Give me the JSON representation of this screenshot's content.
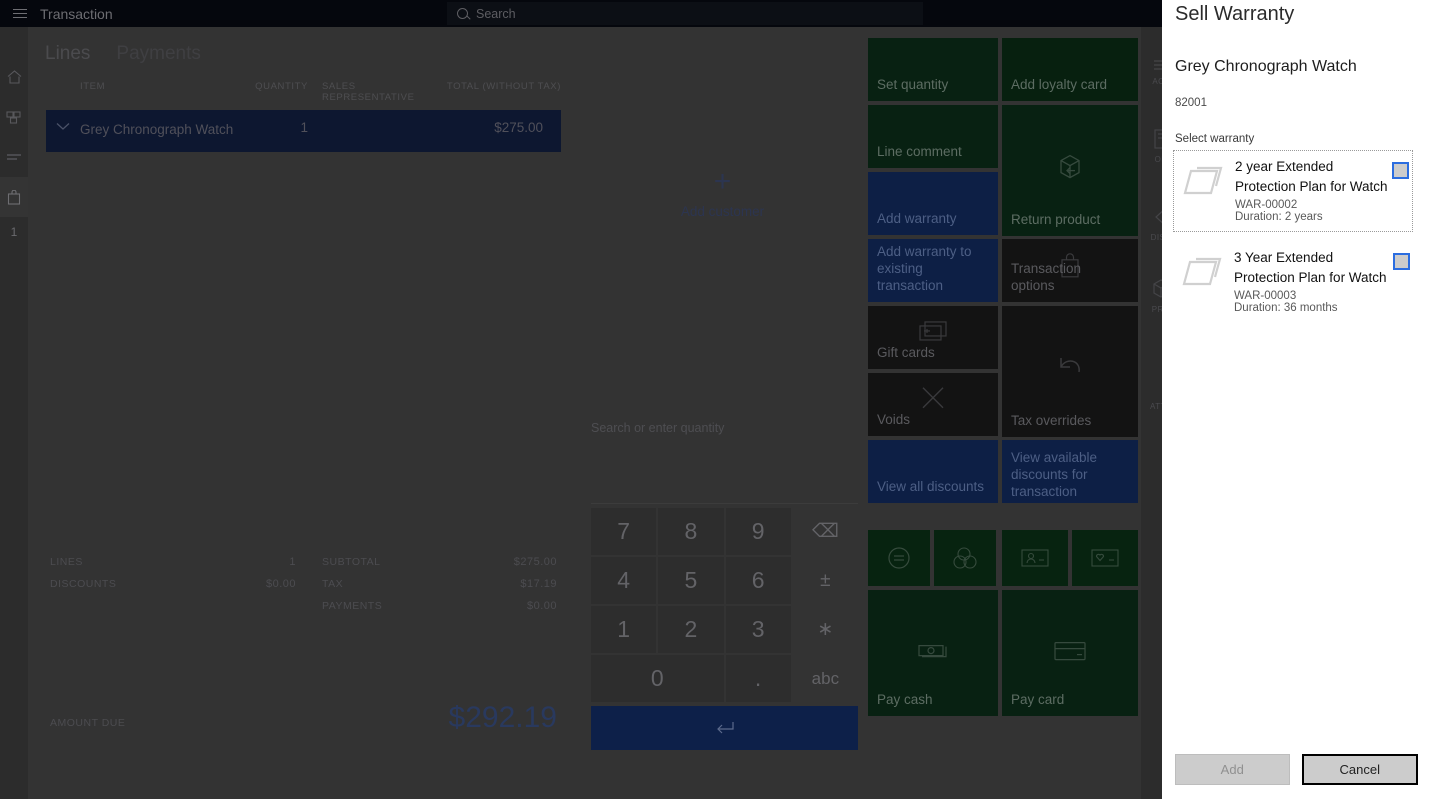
{
  "topbar": {
    "menu_icon": "hamburger-icon",
    "title": "Transaction",
    "search_icon": "search-icon",
    "search_placeholder": "Search"
  },
  "left_rail": {
    "items": [
      {
        "icon": "home-icon",
        "glyph": "⌂"
      },
      {
        "icon": "products-icon",
        "glyph": "❖"
      },
      {
        "icon": "lines-icon",
        "glyph": "≡"
      },
      {
        "icon": "cart-icon",
        "glyph": "▮"
      }
    ],
    "count": "1"
  },
  "transaction": {
    "tabs": [
      {
        "label": "Lines",
        "active": true
      },
      {
        "label": "Payments",
        "active": false
      }
    ],
    "columns": {
      "item": "ITEM",
      "quantity": "QUANTITY",
      "sales_rep": "SALES REPRESENTATIVE",
      "total": "TOTAL (WITHOUT TAX)"
    },
    "rows": [
      {
        "expand_icon": "chevron-down-icon",
        "item": "Grey Chronograph Watch",
        "quantity": "1",
        "sales_rep": "",
        "total": "$275.00"
      }
    ],
    "totals_left": [
      {
        "label": "LINES",
        "value": "1"
      },
      {
        "label": "DISCOUNTS",
        "value": "$0.00"
      }
    ],
    "totals_right": [
      {
        "label": "SUBTOTAL",
        "value": "$275.00"
      },
      {
        "label": "TAX",
        "value": "$17.19"
      },
      {
        "label": "PAYMENTS",
        "value": "$0.00"
      }
    ],
    "amount_due_label": "AMOUNT DUE",
    "amount_due_value": "$292.19"
  },
  "customer": {
    "add_icon": "plus-icon",
    "add_label": "Add customer"
  },
  "keypad": {
    "input_placeholder": "Search or enter quantity",
    "keys": [
      {
        "label": "7",
        "type": "digit"
      },
      {
        "label": "8",
        "type": "digit"
      },
      {
        "label": "9",
        "type": "digit"
      },
      {
        "label": "⌫",
        "type": "fn",
        "icon": "backspace-icon"
      },
      {
        "label": "4",
        "type": "digit"
      },
      {
        "label": "5",
        "type": "digit"
      },
      {
        "label": "6",
        "type": "digit"
      },
      {
        "label": "±",
        "type": "fn",
        "icon": "plus-minus-icon"
      },
      {
        "label": "1",
        "type": "digit"
      },
      {
        "label": "2",
        "type": "digit"
      },
      {
        "label": "3",
        "type": "digit"
      },
      {
        "label": "∗",
        "type": "fn",
        "icon": "asterisk-icon"
      },
      {
        "label": "0",
        "type": "zero"
      },
      {
        "label": ".",
        "type": "digit"
      },
      {
        "label": "abc",
        "type": "abc"
      }
    ],
    "enter_icon": "enter-arrow-icon"
  },
  "tiles": [
    {
      "label": "Set quantity",
      "style": "green",
      "icon": ""
    },
    {
      "label": "Add loyalty card",
      "style": "greendk",
      "icon": ""
    },
    {
      "label": "Line comment",
      "style": "green",
      "icon": ""
    },
    {
      "label": "Return product",
      "style": "green",
      "icon": "return-product-icon"
    },
    {
      "label": "Add warranty",
      "style": "blue",
      "icon": ""
    },
    {
      "label": "Transaction options",
      "style": "dark",
      "icon": "shopping-bag-icon"
    },
    {
      "label": "Add warranty to existing transaction",
      "style": "blue",
      "icon": ""
    },
    {
      "label": "Gift cards",
      "style": "dark",
      "icon": "gift-card-icon"
    },
    {
      "label": "Tax overrides",
      "style": "dark",
      "icon": "undo-arrow-icon"
    },
    {
      "label": "Voids",
      "style": "dark",
      "icon": "close-x-icon"
    },
    {
      "label": "View all discounts",
      "style": "blue",
      "icon": ""
    },
    {
      "label": "View available discounts for transaction",
      "style": "blue",
      "icon": ""
    },
    {
      "label": "Pay cash",
      "style": "green",
      "icon": "cash-icon"
    },
    {
      "label": "Pay card",
      "style": "green",
      "icon": "credit-card-icon"
    }
  ],
  "tiles_small": [
    {
      "icon": "price-check-icon"
    },
    {
      "icon": "coins-icon"
    },
    {
      "icon": "customer-card-icon"
    },
    {
      "icon": "loyalty-card-icon"
    }
  ],
  "right_strip": [
    {
      "icon": "lines-icon",
      "label": "ACT"
    },
    {
      "icon": "order-icon",
      "label": "OR"
    },
    {
      "icon": "discount-tag-icon",
      "label": "DISC"
    },
    {
      "icon": "product-box-icon",
      "label": "PRO"
    },
    {
      "icon": "",
      "label": "ATTR"
    }
  ],
  "dialog": {
    "title": "Sell Warranty",
    "product_name": "Grey Chronograph Watch",
    "product_id": "82001",
    "select_label": "Select warranty",
    "warranties": [
      {
        "icon": "image-placeholder-icon",
        "name": "2 year Extended Protection Plan for Watch",
        "code": "WAR-00002",
        "duration": "Duration: 2 years",
        "checked": false,
        "focused": true
      },
      {
        "icon": "image-placeholder-icon",
        "name": "3 Year Extended Protection Plan for Watch",
        "code": "WAR-00003",
        "duration": "Duration: 36 months",
        "checked": false,
        "focused": false
      }
    ],
    "add_label": "Add",
    "cancel_label": "Cancel"
  },
  "colors": {
    "accent_blue": "#2b6de0",
    "tile_green": "#082112",
    "tile_blue": "#0d1f45",
    "selected_row": "#0d1730",
    "amount_due": "#29395e"
  }
}
